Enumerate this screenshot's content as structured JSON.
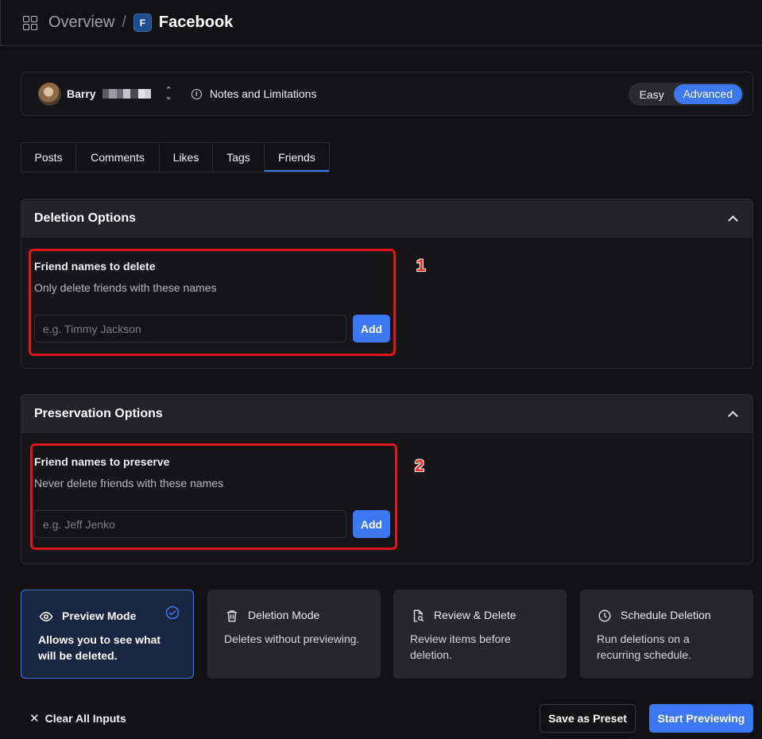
{
  "breadcrumb": {
    "overview": "Overview",
    "separator": "/",
    "platform_badge": "F",
    "title": "Facebook"
  },
  "account": {
    "name": "Barry",
    "notes_label": "Notes and Limitations",
    "mode_options": [
      "Easy",
      "Advanced"
    ],
    "selected_mode": "Advanced"
  },
  "tabs": [
    {
      "label": "Posts"
    },
    {
      "label": "Comments"
    },
    {
      "label": "Likes"
    },
    {
      "label": "Tags"
    },
    {
      "label": "Friends",
      "active": true
    }
  ],
  "deletion": {
    "title": "Deletion Options",
    "field_label": "Friend names to delete",
    "field_help": "Only delete friends with these names",
    "placeholder": "e.g. Timmy Jackson",
    "value": "",
    "add_label": "Add",
    "annotation": "1"
  },
  "preservation": {
    "title": "Preservation Options",
    "field_label": "Friend names to preserve",
    "field_help": "Never delete friends with these names",
    "placeholder": "e.g. Jeff Jenko",
    "value": "",
    "add_label": "Add",
    "annotation": "2"
  },
  "modes": [
    {
      "icon": "eye-icon",
      "title": "Preview Mode",
      "desc": "Allows you to see what will be deleted.",
      "selected": true
    },
    {
      "icon": "trash-icon",
      "title": "Deletion Mode",
      "desc": "Deletes without previewing."
    },
    {
      "icon": "file-search-icon",
      "title": "Review & Delete",
      "desc": "Review items before deletion."
    },
    {
      "icon": "clock-icon",
      "title": "Schedule Deletion",
      "desc": "Run deletions on a recurring schedule."
    }
  ],
  "footer": {
    "clear_label": "Clear All Inputs",
    "preset_label": "Save as Preset",
    "start_label": "Start Previewing"
  },
  "colors": {
    "accent": "#3b78f2",
    "background": "#121214",
    "annotation_red": "#e0141a"
  }
}
